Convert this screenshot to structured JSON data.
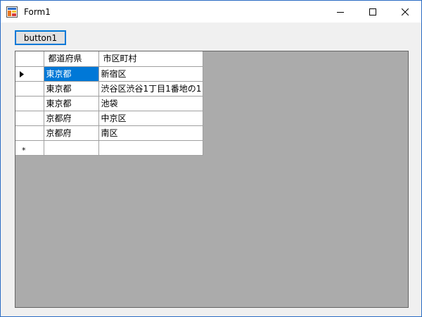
{
  "window": {
    "title": "Form1",
    "accent": "#2b6cc4"
  },
  "toolbar": {
    "button1_label": "button1"
  },
  "grid": {
    "columns": [
      "都道府県",
      "市区町村"
    ],
    "rows": [
      [
        "東京都",
        "新宿区"
      ],
      [
        "東京都",
        "渋谷区渋谷1丁目1番地の1"
      ],
      [
        "東京都",
        "池袋"
      ],
      [
        "京都府",
        "中京区"
      ],
      [
        "京都府",
        "南区"
      ]
    ],
    "new_row_marker": "*",
    "selection_color": "#0078d7",
    "background_color": "#ababab"
  }
}
